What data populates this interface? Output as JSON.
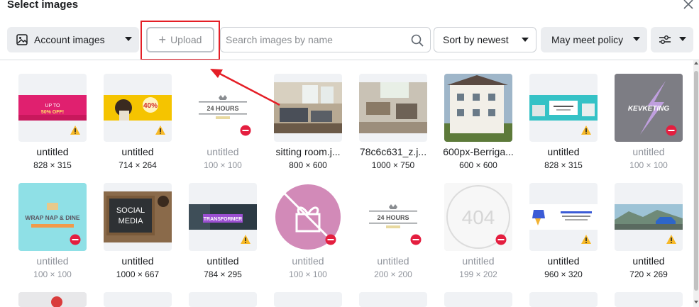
{
  "dialog": {
    "title": "Select images"
  },
  "toolbar": {
    "account_label": "Account images",
    "upload_label": "Upload",
    "search_placeholder": "Search images by name",
    "sort_label": "Sort by newest",
    "policy_label": "May meet policy"
  },
  "images": [
    {
      "name": "untitled",
      "dims": "828 × 315",
      "status": "warning",
      "muted": false
    },
    {
      "name": "untitled",
      "dims": "714 × 264",
      "status": "warning",
      "muted": false
    },
    {
      "name": "untitled",
      "dims": "100 × 100",
      "status": "blocked",
      "muted": true
    },
    {
      "name": "sitting room.j...",
      "dims": "800 × 600",
      "status": "none",
      "muted": false
    },
    {
      "name": "78c6c631_z.j...",
      "dims": "1000 × 750",
      "status": "none",
      "muted": false
    },
    {
      "name": "600px-Berriga...",
      "dims": "600 × 600",
      "status": "none",
      "muted": false
    },
    {
      "name": "untitled",
      "dims": "828 × 315",
      "status": "warning",
      "muted": false
    },
    {
      "name": "untitled",
      "dims": "100 × 100",
      "status": "blocked",
      "muted": true
    },
    {
      "name": "untitled",
      "dims": "100 × 100",
      "status": "blocked",
      "muted": true
    },
    {
      "name": "untitled",
      "dims": "1000 × 667",
      "status": "none",
      "muted": false
    },
    {
      "name": "untitled",
      "dims": "784 × 295",
      "status": "warning",
      "muted": false
    },
    {
      "name": "untitled",
      "dims": "100 × 100",
      "status": "blocked",
      "muted": true
    },
    {
      "name": "untitled",
      "dims": "200 × 200",
      "status": "blocked",
      "muted": true
    },
    {
      "name": "untitled",
      "dims": "199 × 202",
      "status": "blocked",
      "muted": true
    },
    {
      "name": "untitled",
      "dims": "960 × 320",
      "status": "warning",
      "muted": false
    },
    {
      "name": "untitled",
      "dims": "720 × 269",
      "status": "warning",
      "muted": false
    }
  ],
  "thumb_text": {
    "t0_line1": "UP TO",
    "t0_line2": "50% OFF!",
    "t1_pct": "40%",
    "t2_text": "24 HOURS",
    "t7_text": "KEVKETING",
    "t8_line1": "WRAP NAP & DINE",
    "t9_line1": "SOCIAL",
    "t9_line2": "MEDIA",
    "t10_text": "TRANSFORMER",
    "t12_text": "24 HOURS",
    "t13_text": "404"
  },
  "colors": {
    "accent_red": "#e41e26",
    "warning": "#f7b928",
    "blocked": "#e41e3f"
  }
}
